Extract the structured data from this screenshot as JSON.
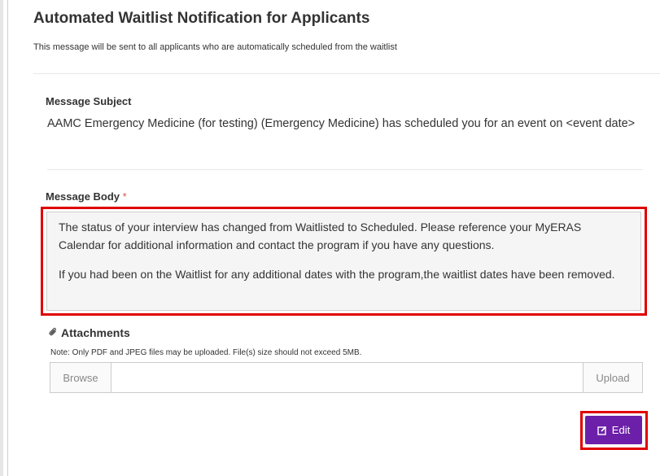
{
  "header": {
    "title": "Automated Waitlist Notification for Applicants",
    "subtitle": "This message will be sent to all applicants who are automatically scheduled from the waitlist"
  },
  "subject": {
    "label": "Message Subject",
    "value": "AAMC Emergency Medicine (for testing) (Emergency Medicine) has scheduled you for an event on <event date>"
  },
  "body": {
    "label": "Message Body",
    "required_marker": "*",
    "paragraphs": [
      "The status of your interview has changed from Waitlisted to Scheduled. Please reference your MyERAS Calendar for additional information and contact the program if you have any questions.",
      "If you had been on the Waitlist for any additional dates with the program,the waitlist dates have been removed."
    ]
  },
  "attachments": {
    "label": "Attachments",
    "icon": "paperclip-icon",
    "note": "Note: Only PDF and JPEG files may be uploaded. File(s) size should not exceed 5MB.",
    "browse_label": "Browse",
    "upload_label": "Upload",
    "file_value": ""
  },
  "actions": {
    "edit_label": "Edit",
    "edit_icon": "edit-icon"
  },
  "colors": {
    "accent": "#6c1fa8",
    "highlight": "#e00000",
    "required": "#d9534f"
  }
}
